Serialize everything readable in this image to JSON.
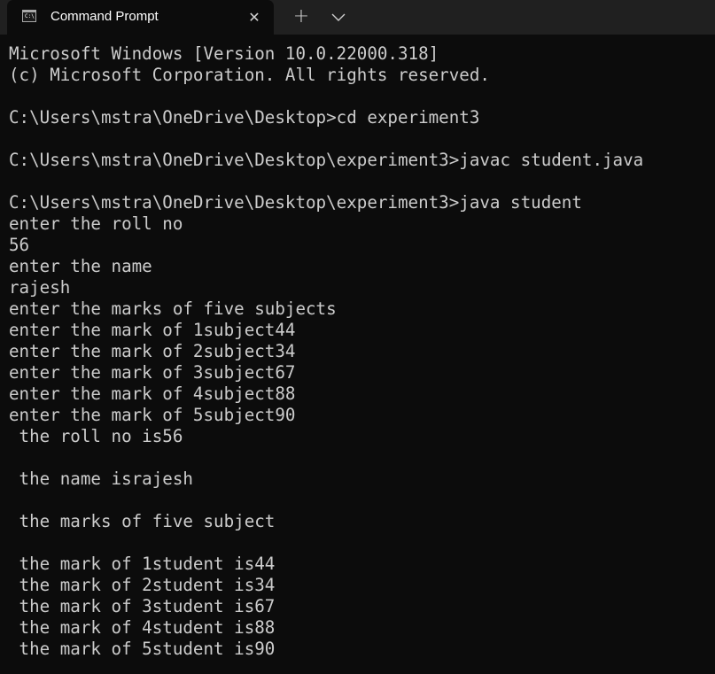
{
  "tab": {
    "title": "Command Prompt",
    "icon": "cmd-icon",
    "close_glyph": "✕",
    "new_tab_glyph": "+"
  },
  "colors": {
    "background": "#0c0c0c",
    "titlebar": "#202020",
    "text": "#cccccc"
  },
  "terminal": {
    "lines": [
      "Microsoft Windows [Version 10.0.22000.318]",
      "(c) Microsoft Corporation. All rights reserved.",
      "",
      "C:\\Users\\mstra\\OneDrive\\Desktop>cd experiment3",
      "",
      "C:\\Users\\mstra\\OneDrive\\Desktop\\experiment3>javac student.java",
      "",
      "C:\\Users\\mstra\\OneDrive\\Desktop\\experiment3>java student",
      "enter the roll no",
      "56",
      "enter the name",
      "rajesh",
      "enter the marks of five subjects",
      "enter the mark of 1subject44",
      "enter the mark of 2subject34",
      "enter the mark of 3subject67",
      "enter the mark of 4subject88",
      "enter the mark of 5subject90",
      " the roll no is56",
      "",
      " the name israjesh",
      "",
      " the marks of five subject",
      "",
      " the mark of 1student is44",
      " the mark of 2student is34",
      " the mark of 3student is67",
      " the mark of 4student is88",
      " the mark of 5student is90"
    ]
  }
}
